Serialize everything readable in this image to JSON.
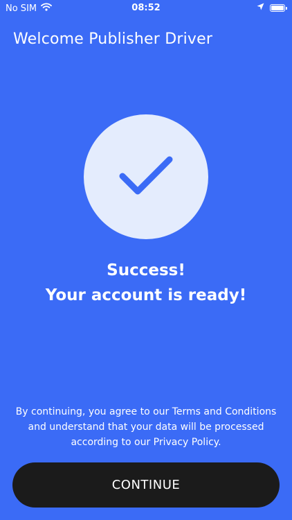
{
  "status_bar": {
    "carrier": "No SIM",
    "time": "08:52",
    "icons": [
      "wifi-icon",
      "location-arrow-icon",
      "battery-icon"
    ]
  },
  "header": {
    "title": "Welcome Publisher Driver"
  },
  "success": {
    "icon": "checkmark-icon",
    "line1": "Success!",
    "line2": "Your account is ready!"
  },
  "legal": {
    "text": "By continuing, you agree to our Terms and Conditions and understand that your data will be processed according to our Privacy Policy."
  },
  "continue_button": {
    "label": "CONTINUE"
  },
  "colors": {
    "background": "#3B6BF6",
    "circle": "#E4ECFD",
    "check": "#3B6BF6",
    "button": "#1B1B1B",
    "text": "#FFFFFF"
  }
}
